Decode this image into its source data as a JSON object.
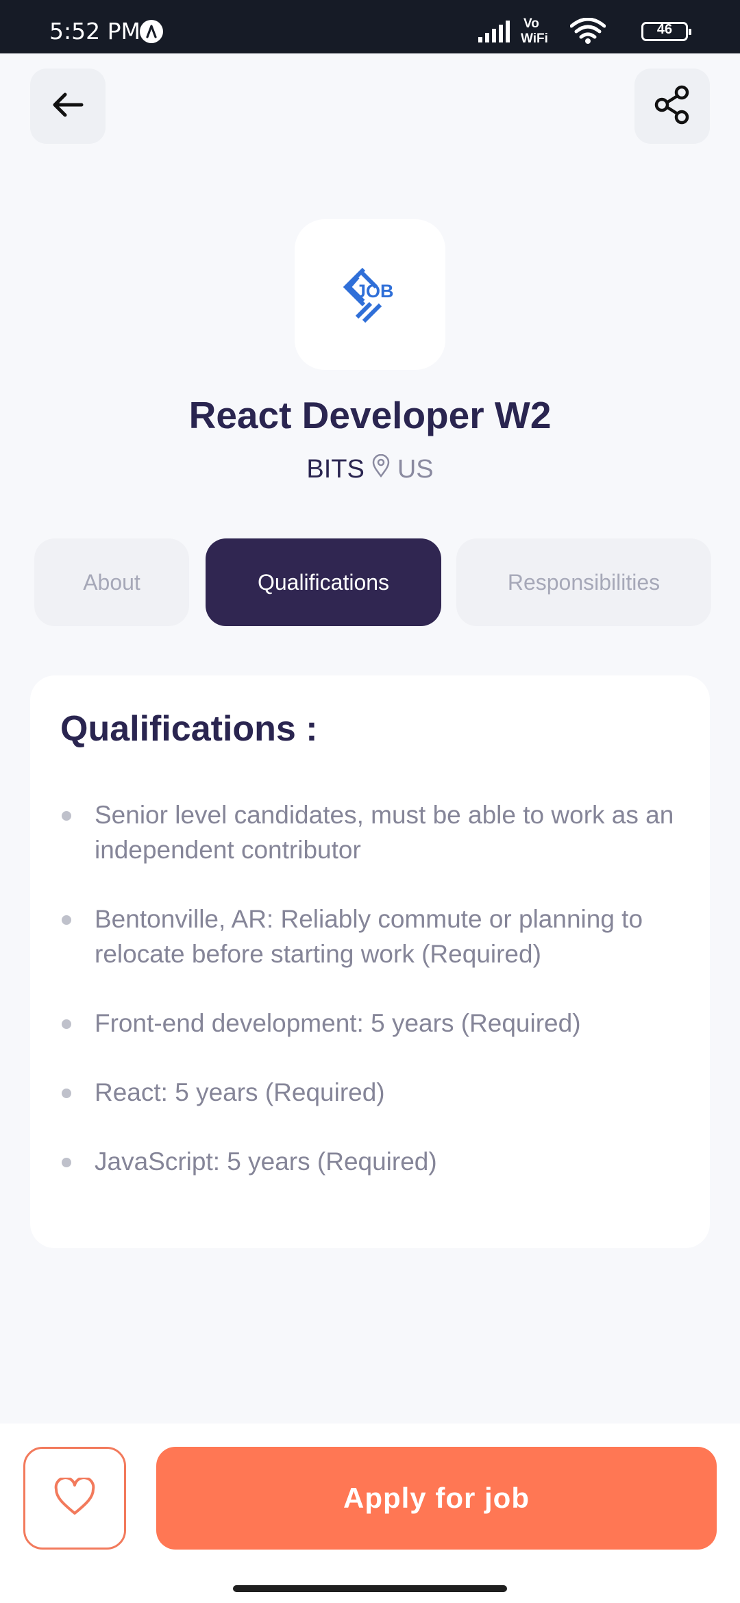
{
  "status_bar": {
    "time": "5:52 PM",
    "network_label": "Vo\nWiFi",
    "battery_level": "46"
  },
  "header": {
    "back_icon": "arrow-left-icon",
    "share_icon": "share-icon"
  },
  "job": {
    "logo_text": "JOB",
    "title": "React Developer W2",
    "company": "BITS",
    "location": "US"
  },
  "tabs": [
    {
      "label": "About",
      "active": false
    },
    {
      "label": "Qualifications",
      "active": true
    },
    {
      "label": "Responsibilities",
      "active": false
    }
  ],
  "content": {
    "heading": "Qualifications :",
    "items": [
      "Senior level candidates, must be able to work as an independent contributor",
      "Bentonville, AR: Reliably commute or planning to relocate before starting work (Required)",
      "Front-end development: 5 years (Required)",
      "React: 5 years (Required)",
      "JavaScript: 5 years (Required)"
    ]
  },
  "footer": {
    "favorite_icon": "heart-icon",
    "apply_label": "Apply for job"
  },
  "colors": {
    "primary_dark": "#302651",
    "accent": "#ff7754",
    "background": "#f7f8fb"
  }
}
